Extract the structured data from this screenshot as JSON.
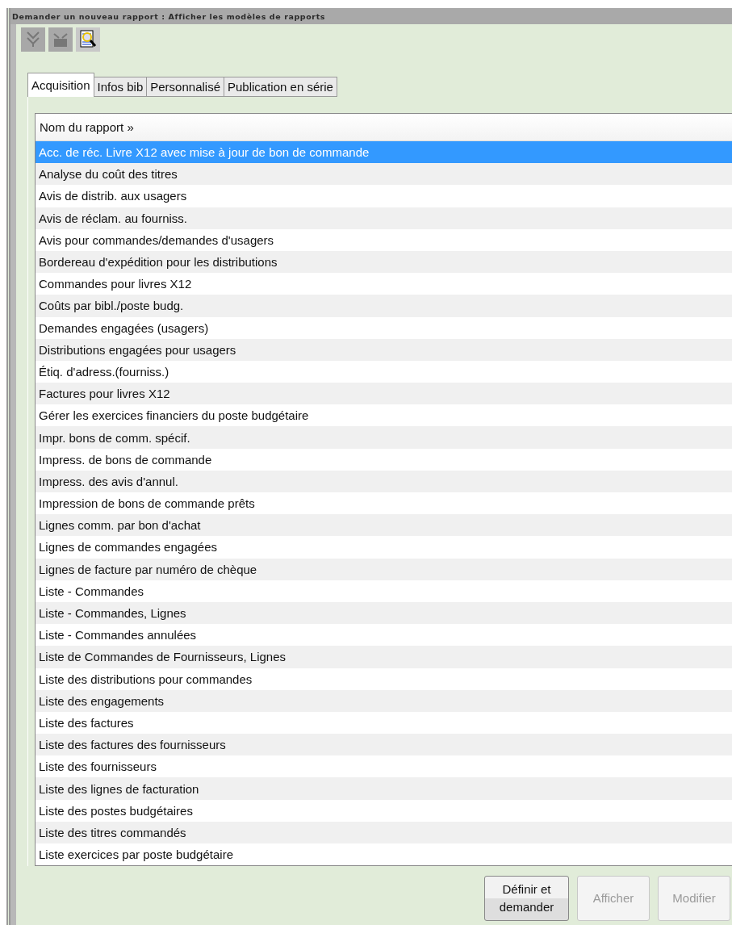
{
  "window": {
    "title": "Demander un nouveau rapport : Afficher les modèles de rapports"
  },
  "toolbar": [
    {
      "kind": "down",
      "disabled": true
    },
    {
      "kind": "tray",
      "disabled": true
    },
    {
      "kind": "preview",
      "disabled": false
    }
  ],
  "tabs": [
    {
      "label": "Acquisition",
      "selected": true
    },
    {
      "label": "Infos bib",
      "selected": false
    },
    {
      "label": "Personnalisé",
      "selected": false
    },
    {
      "label": "Publication en série",
      "selected": false
    }
  ],
  "table": {
    "columns": [
      "Nom du rapport »"
    ],
    "rows": [
      {
        "name": "Acc. de réc. Livre X12 avec mise à jour de bon de commande",
        "selected": true
      },
      {
        "name": "Analyse du coût des titres",
        "selected": false
      },
      {
        "name": "Avis de distrib. aux usagers",
        "selected": false
      },
      {
        "name": "Avis de réclam. au fourniss.",
        "selected": false
      },
      {
        "name": "Avis pour commandes/demandes d'usagers",
        "selected": false
      },
      {
        "name": "Bordereau d'expédition pour les distributions",
        "selected": false
      },
      {
        "name": "Commandes pour livres X12",
        "selected": false
      },
      {
        "name": "Coûts par bibl./poste budg.",
        "selected": false
      },
      {
        "name": "Demandes engagées (usagers)",
        "selected": false
      },
      {
        "name": "Distributions engagées pour usagers",
        "selected": false
      },
      {
        "name": "Étiq. d'adress.(fourniss.)",
        "selected": false
      },
      {
        "name": "Factures pour livres X12",
        "selected": false
      },
      {
        "name": "Gérer les exercices financiers du poste budgétaire",
        "selected": false
      },
      {
        "name": "Impr. bons de comm. spécif.",
        "selected": false
      },
      {
        "name": "Impress. de bons de commande",
        "selected": false
      },
      {
        "name": "Impress. des avis d'annul.",
        "selected": false
      },
      {
        "name": "Impression de bons de commande prêts",
        "selected": false
      },
      {
        "name": "Lignes comm. par bon d'achat",
        "selected": false
      },
      {
        "name": "Lignes de commandes engagées",
        "selected": false
      },
      {
        "name": "Lignes de facture par numéro de chèque",
        "selected": false
      },
      {
        "name": "Liste - Commandes",
        "selected": false
      },
      {
        "name": "Liste - Commandes, Lignes",
        "selected": false
      },
      {
        "name": "Liste - Commandes annulées",
        "selected": false
      },
      {
        "name": "Liste de Commandes de Fournisseurs, Lignes",
        "selected": false
      },
      {
        "name": "Liste des distributions pour commandes",
        "selected": false
      },
      {
        "name": "Liste des engagements",
        "selected": false
      },
      {
        "name": "Liste des factures",
        "selected": false
      },
      {
        "name": "Liste des factures des fournisseurs",
        "selected": false
      },
      {
        "name": "Liste des fournisseurs",
        "selected": false
      },
      {
        "name": "Liste des lignes de facturation",
        "selected": false
      },
      {
        "name": "Liste des postes budgétaires",
        "selected": false
      },
      {
        "name": "Liste des titres commandés",
        "selected": false
      },
      {
        "name": "Liste exercices par poste budgétaire",
        "selected": false
      }
    ]
  },
  "buttons": [
    {
      "label": "Définir et demander",
      "disabled": false
    },
    {
      "label": "Afficher",
      "disabled": true
    },
    {
      "label": "Modifier",
      "disabled": true
    }
  ]
}
